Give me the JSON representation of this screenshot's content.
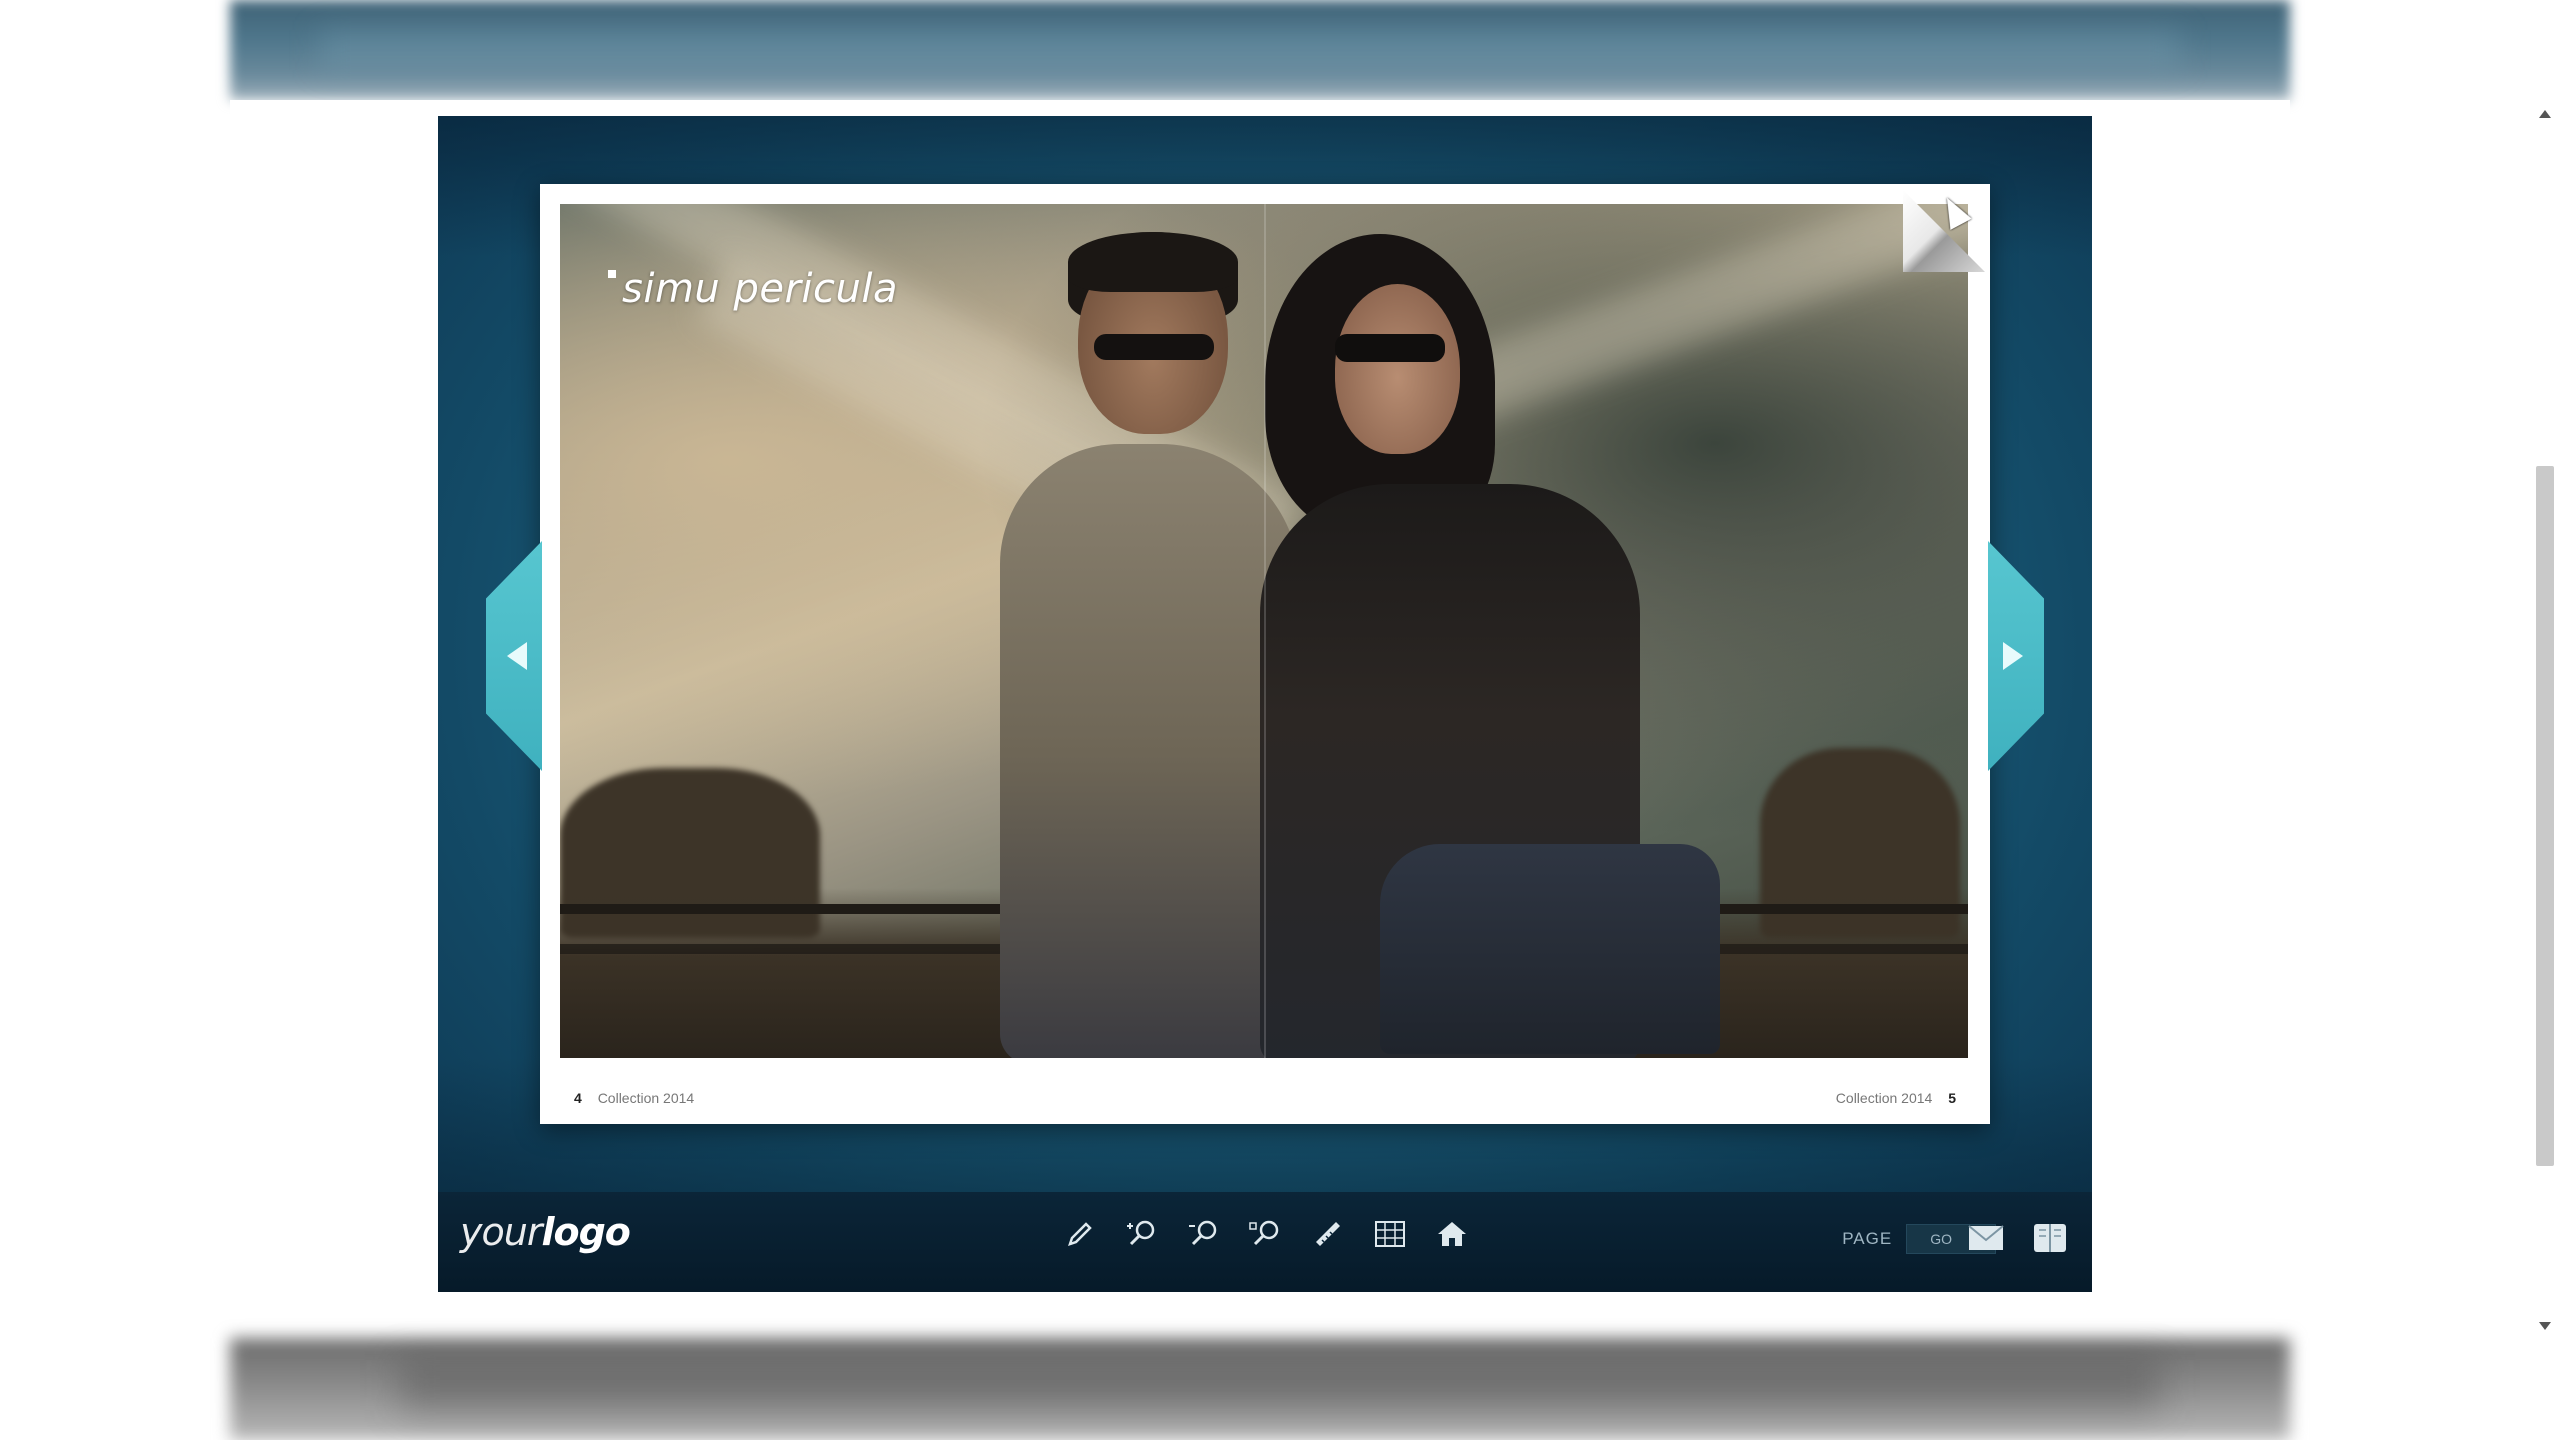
{
  "book": {
    "title": "simu pericula",
    "footer_left_num": "4",
    "footer_left_label": "Collection 2014",
    "footer_right_label": "Collection 2014",
    "footer_right_num": "5"
  },
  "toolbar": {
    "logo_your": "your",
    "logo_brand": "logo",
    "page_label": "PAGE",
    "page_input_value": "",
    "go_label": "GO",
    "tools": [
      {
        "icon": "pencil-icon"
      },
      {
        "icon": "zoom-in-icon"
      },
      {
        "icon": "zoom-out-icon"
      },
      {
        "icon": "zoom-fit-icon"
      },
      {
        "icon": "ruler-icon"
      },
      {
        "icon": "thumbnails-icon"
      },
      {
        "icon": "home-icon"
      }
    ],
    "right_icons": [
      {
        "icon": "email-icon"
      },
      {
        "icon": "book-icon"
      }
    ]
  },
  "colors": {
    "viewer_bg": "#1f6684",
    "toolbar_bg": "#061a29",
    "nav_arrow": "#4bbdc9"
  }
}
